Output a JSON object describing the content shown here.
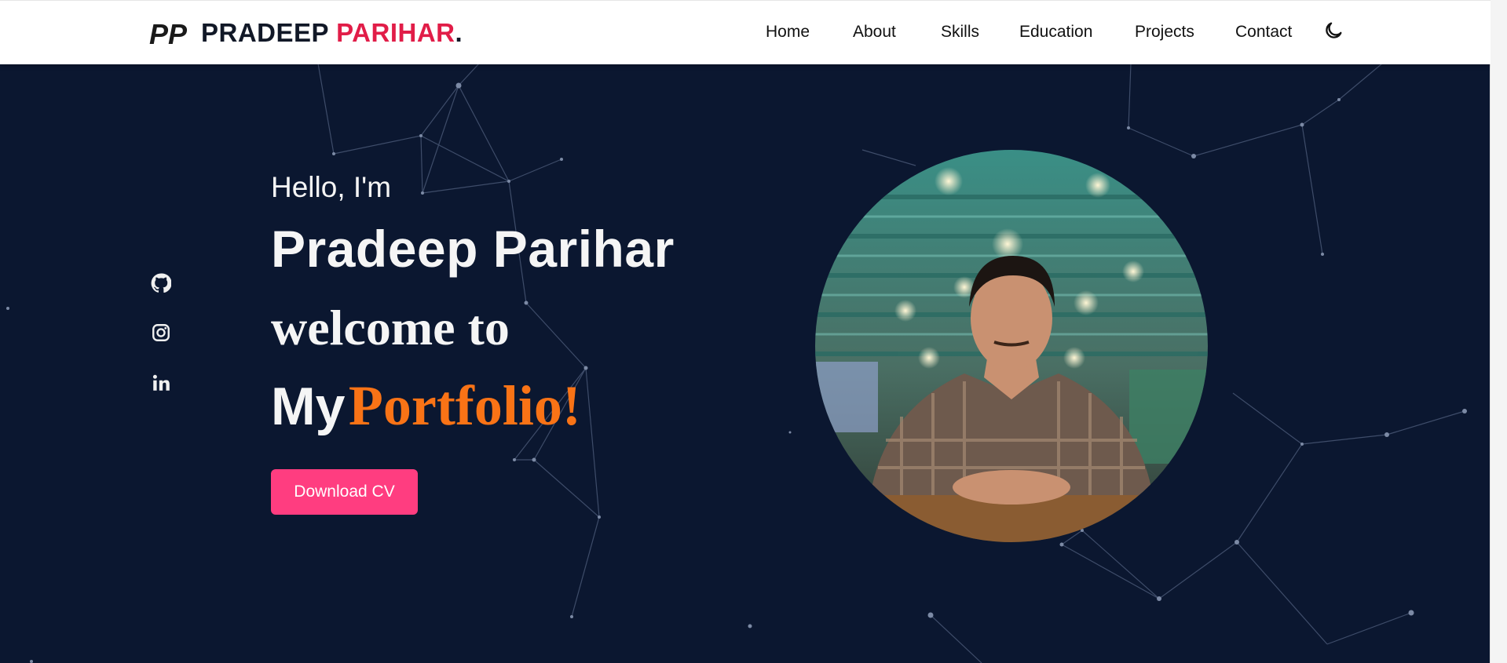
{
  "brand": {
    "logo_text": "PP",
    "name_first": "PRADEEP ",
    "name_accent": "PARIHAR",
    "name_dot": ".",
    "accent_color": "#e11d48"
  },
  "nav": {
    "items": [
      "Home",
      "About",
      "Skills",
      "Education",
      "Projects",
      "Contact"
    ],
    "theme_toggle_icon": "moon-icon"
  },
  "hero": {
    "greeting": "Hello, I'm",
    "name": "Pradeep Parihar",
    "welcome": "welcome to",
    "my": "My",
    "portfolio": "Portfolio!",
    "cta_label": "Download CV",
    "background_color": "#0b1730",
    "cta_color": "#ff3d80",
    "portfolio_color": "#f97316"
  },
  "social": {
    "icons": [
      "github-icon",
      "instagram-icon",
      "linkedin-icon"
    ]
  },
  "photo": {
    "alt": "profile-photo"
  }
}
